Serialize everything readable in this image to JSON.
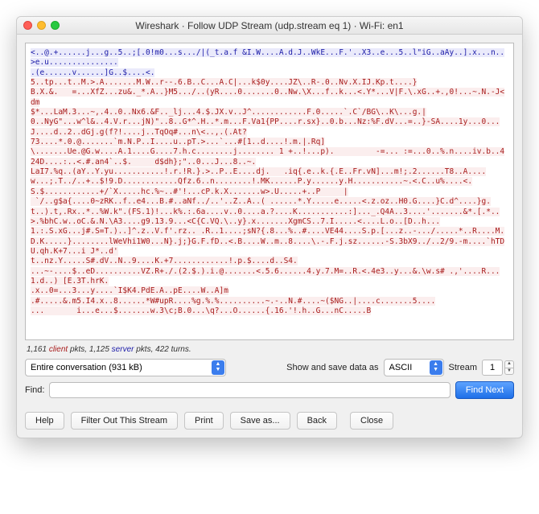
{
  "window": {
    "title": "Wireshark · Follow UDP Stream (udp.stream eq 1) · Wi-Fi: en1"
  },
  "stream": {
    "segments": [
      {
        "dir": "server",
        "text": "<..@.+......j...g..5..;[.0!m0...s.../|(_t.a.f &I.W....A.d.J..WkE...F.'..X3..e...5..l\"iG..aAy..].x...n..>e.u...............\n.(e......v......]G..$....<."
      },
      {
        "dir": "client",
        "text": "\n5..tp...t..M.>.A.......M.W..r--.6.B..C...A.C|...k$0y....JZ\\..R-.0..Nv.X.IJ.Kp.t....}"
      },
      {
        "dir": "client",
        "text": "\nB.X.&.   =...XfZ...zu&._*.A..}M5.../..(yR....0.......0..Nw.\\X...f..k...<.Y*...V|F.\\.xG..+.,0!...~.N.-J<dm\n$*...LaM.3...~,.4..0..Nx6.&F.._lj...4.$.JX.v..J^............F.0.....`.C`/BG\\..K\\...g.|\n0..NyG\"...w^l&..4.V.r...jN)\"..8..G*^.H..*.m...F.Va1{PP....r.sx}..0.b...Nz:%F.dV...=..}-SA....1y...0...J....d..2..dGj.g(f?!....j..TqOq#...n\\<..,.(.At?\n73....*.0.@.......`m.N.P..I....u..pT.>...`...#[1..d....!.m.|.Rq]\n\\.......Ue.@G.w....A.1....G....7.h.c........j........ 1 +..!...p)."
      },
      {
        "dir": "client",
        "text": "         -=... :=...0..%.n....iv.b..424D....:..<.#.an4`..$.     d$dh};\"..0...J...8..~.\nLaI7.%q..(aY..Y.yu...........!.r.!R.}.>..P..E....dj.   .iq{.e..k.{.E..Fr.vN]...m!;.2......T8..A....w...;.T../..+..$!9.D............Qfz.6..n........!.MK......P.y......y.H...........~.<.C..u%....<.S.$............+/`X.....hc.%~..#'!...cP.k.X.......w>.U.....+..P     |\n `/..g$a{....0~zRK..f..e4...B.#..aNf../..'..Z..A..( ......*.Y.....e.....<.z.oz..H0.G....}C.d^....}g.t..).t,.Rx..*..%W.k\".(FS.1)!...k%.:.6a....v..0....a.?....K...........:]..._.Q4A..3....'.......&*.[.*..>.%bhC.w..oC.&.N.\\A3....g9.13.9...<C{C.VQ.\\..y}.x.......XgmCS..7.I.....<....L.o..[D..h...\n1.:.S.xG...j#.S=T.)..]^.z..V.f'.rz.. .R..1....;sN?{.8...%..#....VE44....S.p.[...z..-.../.....*..R....M.D.K.....}........lWeVhi1W0...N}.j;}G.F.fD..<.B....W..m..8....\\.-.F.j.sz......-S.3bX9../..2/9.-m....`hTDU.qh.K+7...i J*..d'\nt..nz.Y.....S#.dV..N..9....K.+7............!.p.$....d..S4.\n...~-....$..eD..........VZ.R+./.(2.$.).i.@.......<.5.6......4.y.7.M=..R.<.4e3..y...&.\\w.s# .,'....R...1.d..) [E.3T.hrK.\n.x..0=...3...y....`I$K4.PdE.A..pE....W..A]m\n.#.....&.m5.I4.x..8......*W#upR....%g.%.%..........~.-..N.#....~($NG..|....c.......5....\n...       i...e...$.......w.3\\c;B.0...\\q?...O......{.16.'!.h..G...nC.....B"
      }
    ]
  },
  "stats": {
    "client_pkts": "1,161",
    "client_word": "client",
    "mid_text": " pkts, ",
    "server_pkts": "1,125",
    "server_word": "server",
    "tail_text": " pkts, 422 turns."
  },
  "controls": {
    "conversation_select": "Entire conversation (931 kB)",
    "show_as_label": "Show and save data as",
    "show_as_value": "ASCII",
    "stream_label": "Stream",
    "stream_value": "1"
  },
  "find": {
    "label": "Find:",
    "value": "",
    "button": "Find Next"
  },
  "buttons": {
    "help": "Help",
    "filter_out": "Filter Out This Stream",
    "print": "Print",
    "save_as": "Save as...",
    "back": "Back",
    "close": "Close"
  }
}
